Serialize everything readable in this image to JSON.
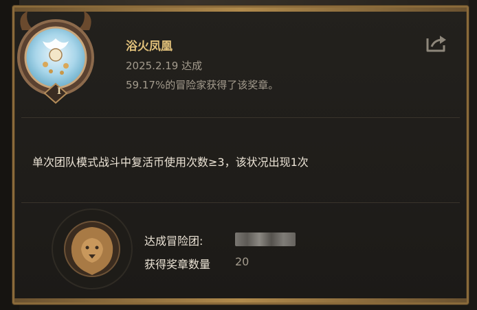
{
  "achievement": {
    "title": "浴火凤凰",
    "date": "2025.2.19 达成",
    "rate": "59.17%的冒险家获得了该奖章。",
    "tier": "I",
    "description": "单次团队模式战斗中复活币使用次数≥3，该状况出现1次"
  },
  "guild": {
    "label": "达成冒险团:",
    "name_redacted": "",
    "medal_count_label": "获得奖章数量",
    "medal_count": "20"
  },
  "colors": {
    "title_gold": "#e0c07a",
    "frame_gold": "#8a6a3a",
    "text_gray": "#a39b8d"
  },
  "icons": {
    "share": "share-icon",
    "medal": "phoenix-medal-icon",
    "emblem": "lion-emblem-icon"
  }
}
